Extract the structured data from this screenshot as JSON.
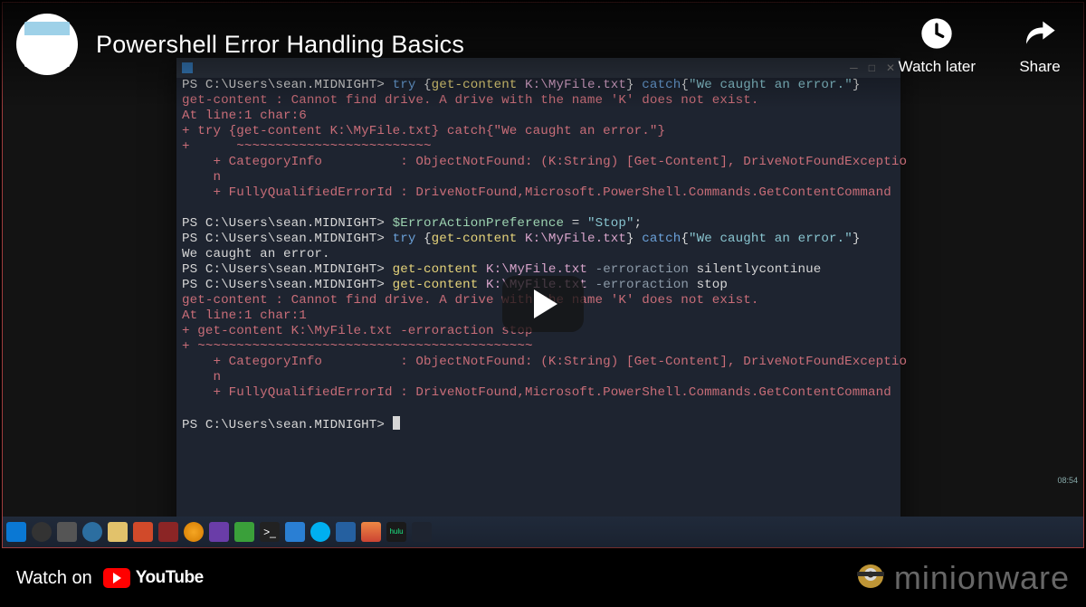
{
  "video": {
    "title": "Powershell Error Handling Basics",
    "watch_later_label": "Watch later",
    "share_label": "Share",
    "watch_on_label": "Watch on",
    "youtube_label": "YouTube"
  },
  "brand": {
    "name": "minionware"
  },
  "terminal": {
    "prompt": "PS C:\\Users\\sean.MIDNIGHT>",
    "lines": {
      "l1_try": "try",
      "l1_open": " {",
      "l1_cmd": "get-content",
      "l1_path": " K:\\MyFile.txt",
      "l1_close": "} ",
      "l1_catch": "catch",
      "l1_cbrace": "{",
      "l1_msg": "\"We caught an error.\"",
      "l1_end": "}",
      "e1a": "get-content : Cannot find drive. A drive with the name 'K' does not exist.",
      "e1b": "At line:1 char:6",
      "e1c": "+ try {get-content K:\\MyFile.txt} catch{\"We caught an error.\"}",
      "e1d": "+      ~~~~~~~~~~~~~~~~~~~~~~~~~",
      "e1e": "    + CategoryInfo          : ObjectNotFound: (K:String) [Get-Content], DriveNotFoundExceptio",
      "e1f": "    n",
      "e1g": "    + FullyQualifiedErrorId : DriveNotFound,Microsoft.PowerShell.Commands.GetContentCommand",
      "l2_var": "$ErrorActionPreference",
      "l2_eq": " = ",
      "l2_val": "\"Stop\"",
      "l2_semi": ";",
      "caught": "We caught an error.",
      "l3_cmd": "get-content",
      "l3_path": " K:\\MyFile.txt",
      "l3_flag": " -erroraction",
      "l3_val": " silentlycontinue",
      "l4_cmd": "get-content",
      "l4_path": " K:\\MyFile.txt",
      "l4_flag": " -erroraction",
      "l4_val": " stop",
      "e2a": "get-content : Cannot find drive. A drive with the name 'K' does not exist.",
      "e2b": "At line:1 char:1",
      "e2c": "+ get-content K:\\MyFile.txt -erroraction stop",
      "e2d": "+ ~~~~~~~~~~~~~~~~~~~~~~~~~~~~~~~~~~~~~~~~~~~",
      "e2e": "    + CategoryInfo          : ObjectNotFound: (K:String) [Get-Content], DriveNotFoundExceptio",
      "e2f": "    n",
      "e2g": "    + FullyQualifiedErrorId : DriveNotFound,Microsoft.PowerShell.Commands.GetContentCommand"
    },
    "tray_time": "08:54"
  }
}
